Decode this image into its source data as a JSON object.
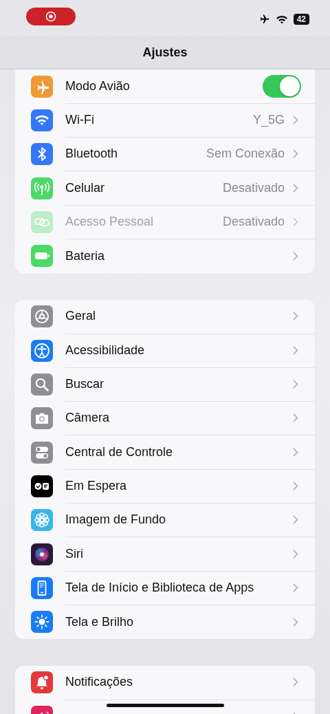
{
  "status_bar": {
    "recording": true,
    "battery": "42",
    "airplane": true
  },
  "title": "Ajustes",
  "groups": [
    {
      "rows": [
        {
          "kind": "toggle",
          "color": "#f09a37",
          "label": "Modo Avião",
          "on": true,
          "disabled": false
        },
        {
          "kind": "link",
          "color": "#3478f6",
          "label": "Wi-Fi",
          "value": "Y_5G",
          "disabled": false
        },
        {
          "kind": "link",
          "color": "#3478f6",
          "label": "Bluetooth",
          "value": "Sem Conexão",
          "disabled": false
        },
        {
          "kind": "link",
          "color": "#4cd964",
          "label": "Celular",
          "value": "Desativado",
          "disabled": false
        },
        {
          "kind": "link",
          "color": "#bdeec8",
          "label": "Acesso Pessoal",
          "value": "Desativado",
          "disabled": true
        },
        {
          "kind": "link",
          "color": "#4cd964",
          "label": "Bateria",
          "disabled": false
        }
      ]
    },
    {
      "rows": [
        {
          "kind": "link",
          "color": "#8e8e93",
          "label": "Geral",
          "disabled": false
        },
        {
          "kind": "link",
          "color": "#1a7cf5",
          "label": "Acessibilidade",
          "disabled": false
        },
        {
          "kind": "link",
          "color": "#8e8e93",
          "label": "Buscar",
          "disabled": false
        },
        {
          "kind": "link",
          "color": "#8e8e93",
          "label": "Câmera",
          "disabled": false
        },
        {
          "kind": "link",
          "color": "#8e8e93",
          "label": "Central de Controle",
          "disabled": false
        },
        {
          "kind": "link",
          "color": "#000000",
          "label": "Em Espera",
          "disabled": false
        },
        {
          "kind": "link",
          "color": "#38b6e8",
          "label": "Imagem de Fundo",
          "disabled": false
        },
        {
          "kind": "link",
          "color": "#2a1a3a",
          "label": "Siri",
          "disabled": false
        },
        {
          "kind": "link",
          "color": "#1a7cf5",
          "label": "Tela de Início e Biblioteca de Apps",
          "disabled": false
        },
        {
          "kind": "link",
          "color": "#1a7cf5",
          "label": "Tela e Brilho",
          "disabled": false
        }
      ]
    },
    {
      "rows": [
        {
          "kind": "link",
          "color": "#e5383b",
          "label": "Notificações",
          "disabled": false
        },
        {
          "kind": "link",
          "color": "#e0245e",
          "disabled": false
        }
      ]
    }
  ]
}
